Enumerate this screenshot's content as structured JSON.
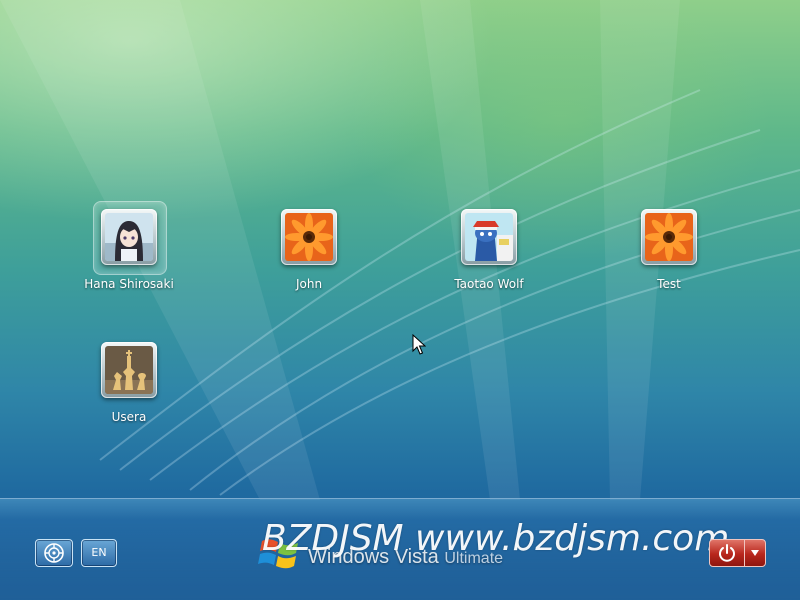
{
  "users": [
    {
      "name": "Hana Shirosaki",
      "picture": "anime-girl-picture",
      "selected": true
    },
    {
      "name": "John",
      "picture": "orange-flower-picture",
      "selected": false
    },
    {
      "name": "Taotao Wolf",
      "picture": "cartoon-character-picture",
      "selected": false
    },
    {
      "name": "Test",
      "picture": "orange-flower-picture",
      "selected": false
    },
    {
      "name": "Usera",
      "picture": "chess-pieces-picture",
      "selected": false
    }
  ],
  "bottom": {
    "ease_of_access_icon": "ease-of-access-icon",
    "language": "EN",
    "brand_name": "Windows Vista",
    "brand_edition": "Ultimate",
    "watermark": "BZDJSM www.bzdjsm.com",
    "shutdown_icon": "power-icon",
    "options_icon": "arrow-down-icon"
  },
  "colors": {
    "shutdown_red": "#b8261c",
    "button_blue": "#2c6aa6"
  }
}
